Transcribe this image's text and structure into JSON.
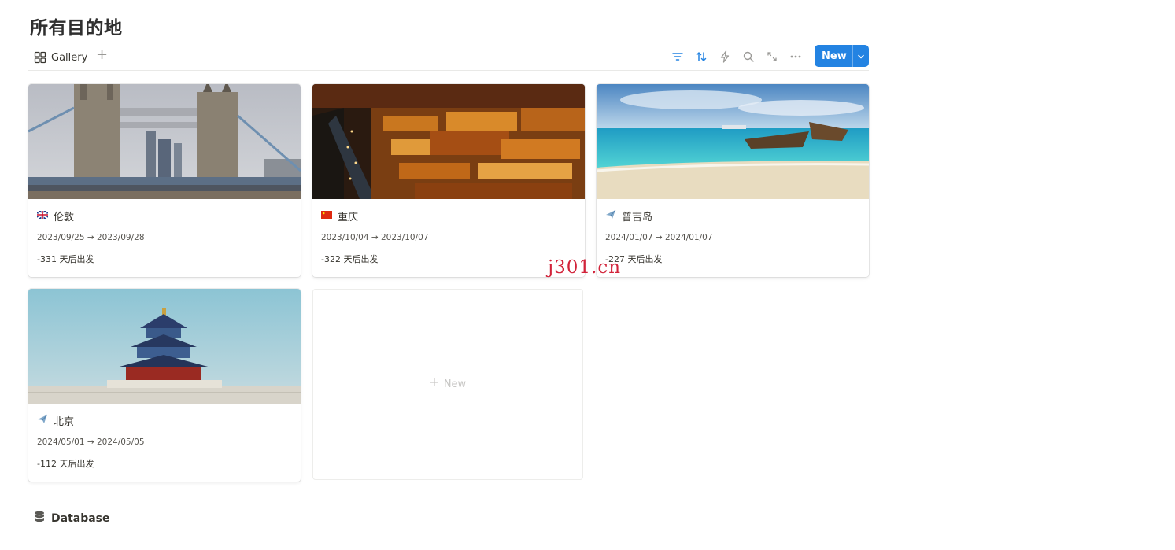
{
  "page": {
    "title": "所有目的地"
  },
  "view": {
    "tab_label": "Gallery",
    "tab_icon": "gallery-grid-icon",
    "add_icon": "plus-icon",
    "tools": [
      "filter-icon",
      "sort-icon",
      "automation-bolt-icon",
      "search-icon",
      "expand-icon",
      "more-icon"
    ],
    "new_label": "New",
    "new_chevron": "chevron-down-icon",
    "accent_color": "#2383e2"
  },
  "cards": [
    {
      "icon": "uk-flag-icon",
      "title": "伦敦",
      "date": "2023/09/25 → 2023/09/28",
      "countdown": "-331 天后出发",
      "cover": "tower-bridge-photo"
    },
    {
      "icon": "china-flag-icon",
      "title": "重庆",
      "date": "2023/10/04 → 2023/10/07",
      "countdown": "-322 天后出发",
      "cover": "chongqing-night-photo"
    },
    {
      "icon": "airplane-icon",
      "title": "普吉岛",
      "date": "2024/01/07 → 2024/01/07",
      "countdown": "-227 天后出发",
      "cover": "phuket-beach-photo"
    },
    {
      "icon": "airplane-icon",
      "title": "北京",
      "date": "2024/05/01 → 2024/05/05",
      "countdown": "-112 天后出发",
      "cover": "temple-of-heaven-photo"
    }
  ],
  "new_card": {
    "label": "New"
  },
  "watermark": "j301.cn",
  "database": {
    "label": "Database",
    "icon": "database-icon"
  }
}
